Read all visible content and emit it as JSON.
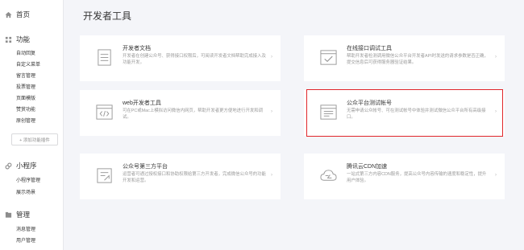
{
  "sidebar": {
    "home_label": "首页",
    "sections": [
      {
        "title": "功能",
        "items": [
          "自动回复",
          "自定义菜单",
          "留言管理",
          "投票管理",
          "页面模版",
          "赞赏功能",
          "原创管理"
        ]
      },
      {
        "title": "小程序",
        "items": [
          "小程序管理",
          "展示场景"
        ]
      },
      {
        "title": "管理",
        "items": [
          "消息管理",
          "用户管理"
        ]
      }
    ],
    "add_plugin_label": "+ 添加功能插件"
  },
  "main": {
    "title": "开发者工具",
    "cards": [
      {
        "title": "开发者文档",
        "desc": "开发者在创建公众号、获得接口权限后，可阅读开发者文档帮助完成接入及功能开发。",
        "icon": "document-icon"
      },
      {
        "title": "在线接口调试工具",
        "desc": "帮助开发者检测调用微信公众平台开发者API时发送的请求参数是否正确，提交信息后可获得服务器验证结果。",
        "icon": "debug-check-icon"
      },
      {
        "title": "web开发者工具",
        "desc": "可在PC或Mac上模拟访问微信内网页，帮助开发者更方便地进行开发和调试。",
        "icon": "code-icon"
      },
      {
        "title": "公众平台测试帐号",
        "desc": "无需申请公众帐号、可在测试帐号中体验并测试微信公众平台所有高级接口。",
        "icon": "test-account-icon"
      },
      {
        "title": "公众号第三方平台",
        "desc": "运营者可通过授权接口和协助权限给第三方开发者，完成微信公众号的功能开发和运营。",
        "icon": "third-party-icon"
      },
      {
        "title": "腾讯云CDN加速",
        "desc": "一站式第三方内容CDN服务，提高公众号内容传输的速度和稳定性，提升用户体验。",
        "icon": "cloud-icon"
      }
    ],
    "chevron": "›"
  },
  "colors": {
    "highlight": "#e0262b",
    "text": "#353535",
    "muted": "#9a9a9a",
    "bg": "#f4f5f9"
  }
}
